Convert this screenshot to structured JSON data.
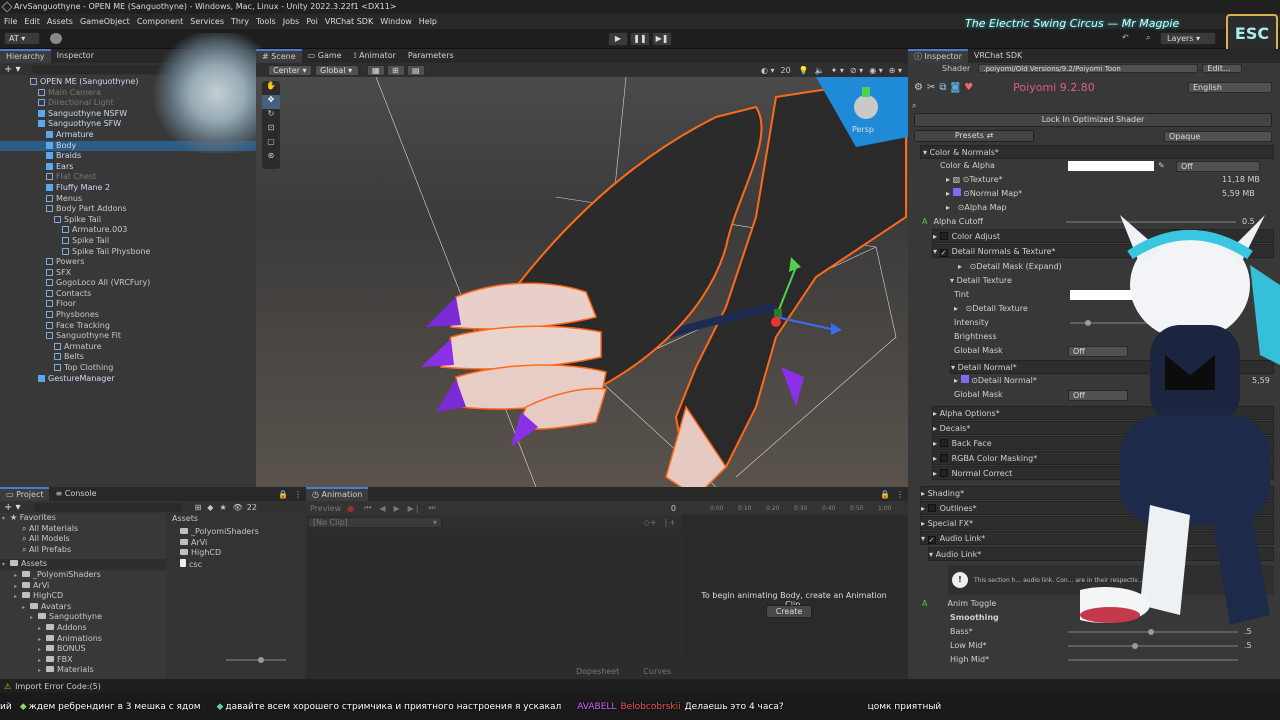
{
  "window": {
    "title": "ArvSanguothyne - OPEN ME (Sanguothyne) - Windows, Mac, Linux - Unity 2022.3.22f1 <DX11>"
  },
  "menu": [
    "File",
    "Edit",
    "Assets",
    "GameObject",
    "Component",
    "Services",
    "Thry",
    "Tools",
    "Jobs",
    "Poi",
    "VRChat SDK",
    "Window",
    "Help"
  ],
  "toolbar": {
    "account": "AT",
    "layers_label": "Layers"
  },
  "overlay": {
    "music": "The Electric Swing Circus — Mr Magpie",
    "badge": "ESC"
  },
  "hierarchy": {
    "tabs": [
      "Hierarchy",
      "Inspector"
    ],
    "items": [
      {
        "label": "OPEN ME (Sanguothyne)",
        "indent": 0,
        "kind": "scene"
      },
      {
        "label": "Main Camera",
        "indent": 1,
        "kind": "dim"
      },
      {
        "label": "Directional Light",
        "indent": 1,
        "kind": "dim"
      },
      {
        "label": "Sanguothyne NSFW",
        "indent": 1,
        "kind": "blue"
      },
      {
        "label": "Sanguothyne SFW",
        "indent": 1,
        "kind": "blue"
      },
      {
        "label": "Armature",
        "indent": 2,
        "kind": "blue"
      },
      {
        "label": "Body",
        "indent": 2,
        "kind": "blue",
        "selected": true
      },
      {
        "label": "Braids",
        "indent": 2,
        "kind": "blue"
      },
      {
        "label": "Ears",
        "indent": 2,
        "kind": "blue"
      },
      {
        "label": "Flat Chest",
        "indent": 2,
        "kind": "dim"
      },
      {
        "label": "Fluffy Mane 2",
        "indent": 2,
        "kind": "blue"
      },
      {
        "label": "Menus",
        "indent": 2,
        "kind": "w"
      },
      {
        "label": "Body Part Addons",
        "indent": 2,
        "kind": "w"
      },
      {
        "label": "Spike Tail",
        "indent": 3,
        "kind": "w"
      },
      {
        "label": "Armature.003",
        "indent": 4,
        "kind": "w"
      },
      {
        "label": "Spike Tail",
        "indent": 4,
        "kind": "w"
      },
      {
        "label": "Spike Tail Physbone",
        "indent": 4,
        "kind": "w"
      },
      {
        "label": "Powers",
        "indent": 2,
        "kind": "w"
      },
      {
        "label": "SFX",
        "indent": 2,
        "kind": "w"
      },
      {
        "label": "GogoLoco All (VRCFury)",
        "indent": 2,
        "kind": "w"
      },
      {
        "label": "Contacts",
        "indent": 2,
        "kind": "w"
      },
      {
        "label": "Floor",
        "indent": 2,
        "kind": "w"
      },
      {
        "label": "Physbones",
        "indent": 2,
        "kind": "w"
      },
      {
        "label": "Face Tracking",
        "indent": 2,
        "kind": "w"
      },
      {
        "label": "Sanguothyne Fit",
        "indent": 2,
        "kind": "w"
      },
      {
        "label": "Armature",
        "indent": 3,
        "kind": "w"
      },
      {
        "label": "Belts",
        "indent": 3,
        "kind": "w"
      },
      {
        "label": "Top Clothing",
        "indent": 3,
        "kind": "w"
      },
      {
        "label": "GestureManager",
        "indent": 1,
        "kind": "blue"
      }
    ]
  },
  "scene": {
    "tabs": [
      "Scene",
      "Game",
      "Animator",
      "Parameters"
    ],
    "pivot": "Center",
    "space": "Global",
    "grid_count": "20",
    "persp": "Persp"
  },
  "project": {
    "tabs": [
      "Project",
      "Console"
    ],
    "count": "22",
    "favorites_title": "Favorites",
    "favorites": [
      "All Materials",
      "All Models",
      "All Prefabs"
    ],
    "assets_title": "Assets",
    "tree": [
      {
        "label": "_PolyomiShaders",
        "indent": 1
      },
      {
        "label": "ArVi",
        "indent": 1
      },
      {
        "label": "HighCD",
        "indent": 1
      },
      {
        "label": "Avatars",
        "indent": 2
      },
      {
        "label": "Sanguothyne",
        "indent": 3
      },
      {
        "label": "Addons",
        "indent": 4
      },
      {
        "label": "Animations",
        "indent": 4
      },
      {
        "label": "BONUS",
        "indent": 4
      },
      {
        "label": "FBX",
        "indent": 4
      },
      {
        "label": "Materials",
        "indent": 4
      }
    ],
    "breadcrumb": "Assets",
    "files": [
      "_PolyomiShaders",
      "ArVi",
      "HighCD",
      "csc"
    ]
  },
  "animation": {
    "tab": "Animation",
    "preview": "Preview",
    "clip": "[No Clip]",
    "frame": "0",
    "ticks": [
      "0:00",
      "0:10",
      "0:20",
      "0:30",
      "0:40",
      "0:50",
      "1:00"
    ],
    "message": "To begin animating Body, create an Animation Clip.",
    "create": "Create",
    "dopesheet": "Dopesheet",
    "curves": "Curves"
  },
  "inspector": {
    "tabs": [
      "Inspector",
      "VRChat SDK"
    ],
    "shader_label": "Shader",
    "shader_value": ".poiyomi/Old Versions/9.2/Poiyomi Toon",
    "edit": "Edit...",
    "title": "Poiyomi 9.2.80",
    "language": "English",
    "lock": "Lock In Optimized Shader",
    "presets": "Presets",
    "render_mode": "Opaque",
    "section_color": "Color & Normals*",
    "color_alpha": "Color & Alpha",
    "off": "Off",
    "texture": "Texture*",
    "texture_size": "11,18 MB",
    "normal_map": "Normal Map*",
    "normal_size": "5,59 MB",
    "alpha_map": "Alpha Map",
    "alpha_cutoff": "Alpha Cutoff",
    "alpha_cutoff_value": "0.5",
    "color_adjust": "Color Adjust",
    "detail_nt": "Detail Normals & Texture*",
    "detail_mask": "Detail Mask (Expand)",
    "detail_texture_hdr": "Detail Texture",
    "tint": "Tint",
    "detail_texture": "Detail Texture",
    "intensity": "Intensity",
    "brightness": "Brightness",
    "global_mask": "Global Mask",
    "detail_normal_hdr": "Detail Normal*",
    "detail_normal": "Detail Normal*",
    "detail_normal_size": "5,59",
    "global_mask2": "Global Mask",
    "alpha_options": "Alpha Options*",
    "decals": "Decals*",
    "back_face": "Back Face",
    "rgba_masking": "RGBA Color Masking*",
    "normal_correct": "Normal Correct",
    "shading": "Shading*",
    "outlines": "Outlines*",
    "special_fx": "Special FX*",
    "audio_link": "Audio Link*",
    "audio_link_sub": "Audio Link*",
    "info": "This section h... audio link. Con... are in their respectiv... ...etc...)",
    "anim_toggle": "Anim Toggle",
    "smoothing": "Smoothing",
    "bass": "Bass*",
    "low_mid": "Low Mid*",
    "high_mid": "High Mid*",
    "val_5": ".5"
  },
  "status": {
    "error": "Import Error Code:(5)"
  },
  "chat": {
    "segments": [
      "ий",
      "ждем ребрендинг в 3 мешка с ядом",
      "давайте всем хорошего стримчика и приятного настроения я ускакал",
      "AVABELL",
      "Belobcobrskii",
      "Делаешь это 4 часа?",
      "цомк приятный"
    ]
  },
  "colors": {
    "accent": "#4a7bd0",
    "selected": "#2c5d87",
    "title_pink": "#e05b8c",
    "orange_outline": "#ff6a1a"
  }
}
